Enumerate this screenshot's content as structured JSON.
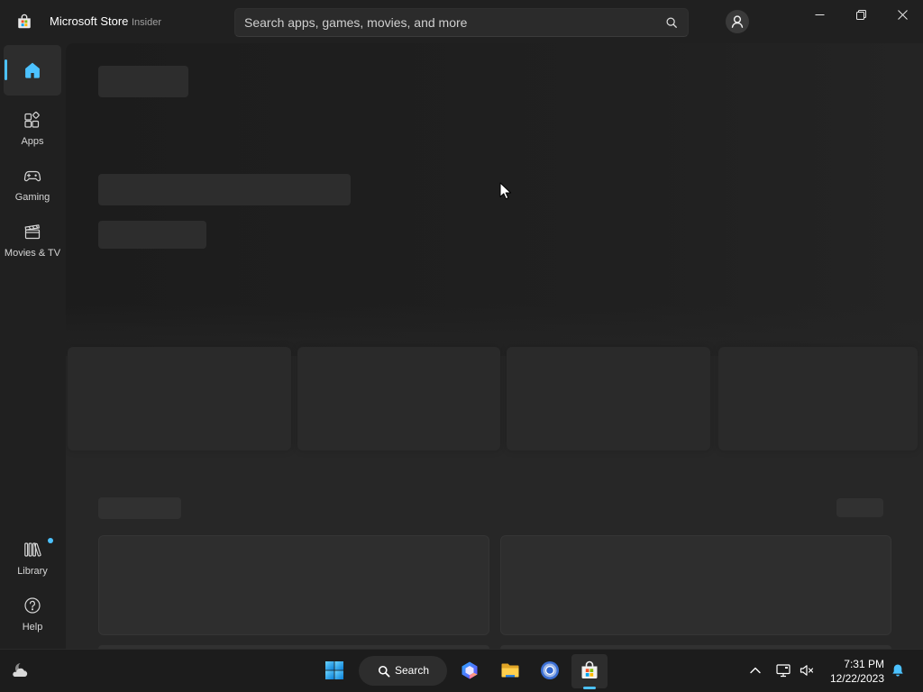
{
  "theme": {
    "accent": "#4cc2ff",
    "update_badge": "#4cc2ff"
  },
  "titlebar": {
    "app_icon": "microsoft-store-icon",
    "app_name": "Microsoft Store",
    "channel": "Insider",
    "account_icon": "account-icon",
    "controls": [
      "minimize-icon",
      "restore-icon",
      "close-icon"
    ]
  },
  "search": {
    "placeholder": "Search apps, games, movies, and more",
    "value": "",
    "icon": "search-icon"
  },
  "nav": {
    "items": [
      {
        "icon": "home-icon",
        "selected": true
      },
      {
        "icon": "apps-icon",
        "label": "Apps"
      },
      {
        "icon": "game-controller-icon",
        "label": "Gaming"
      },
      {
        "icon": "clapperboard-icon",
        "label": "Movies & TV"
      }
    ],
    "bottom_items": [
      {
        "icon": "library-icon",
        "label": "Library",
        "update_badge": true
      },
      {
        "icon": "help-icon",
        "label": "Help"
      }
    ]
  },
  "taskbar": {
    "widgets_icon": "weather-icon",
    "start_icon": "windows-logo-icon",
    "search_label": "Search",
    "pinned_apps": [
      {
        "icon": "copilot-icon"
      },
      {
        "icon": "file-explorer-icon"
      },
      {
        "icon": "chrome-icon"
      },
      {
        "icon": "microsoft-store-icon",
        "active": true
      }
    ],
    "tray": {
      "icons": [
        "chevron-up-icon",
        "network-icon",
        "volume-muted-icon",
        "notification-bell-icon"
      ],
      "time": "7:31 PM",
      "date": "12/22/2023"
    }
  }
}
